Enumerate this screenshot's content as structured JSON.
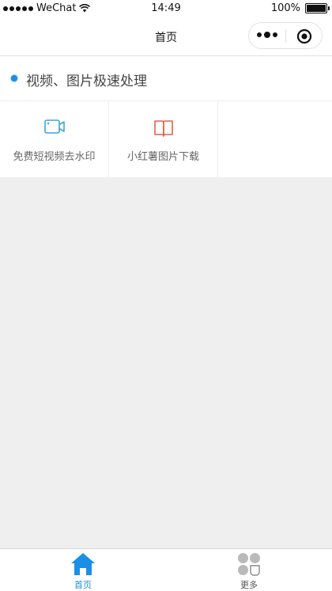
{
  "status_bar": {
    "carrier": "WeChat",
    "time": "14:49",
    "battery": "100%"
  },
  "navbar": {
    "title": "首页"
  },
  "section": {
    "title": "视频、图片极速处理"
  },
  "tools": [
    {
      "label": "免费短视频去水印",
      "icon": "video-camera-icon",
      "color": "#3aa6d8"
    },
    {
      "label": "小红薯图片下载",
      "icon": "book-open-icon",
      "color": "#e0614d"
    }
  ],
  "tabbar": {
    "items": [
      {
        "label": "首页",
        "icon": "home-icon",
        "active": true,
        "color": "#1a8fe6"
      },
      {
        "label": "更多",
        "icon": "more-grid-icon",
        "active": false,
        "color": "#555555"
      }
    ]
  },
  "colors": {
    "accent": "#1a8fe6",
    "background": "#efefef"
  }
}
